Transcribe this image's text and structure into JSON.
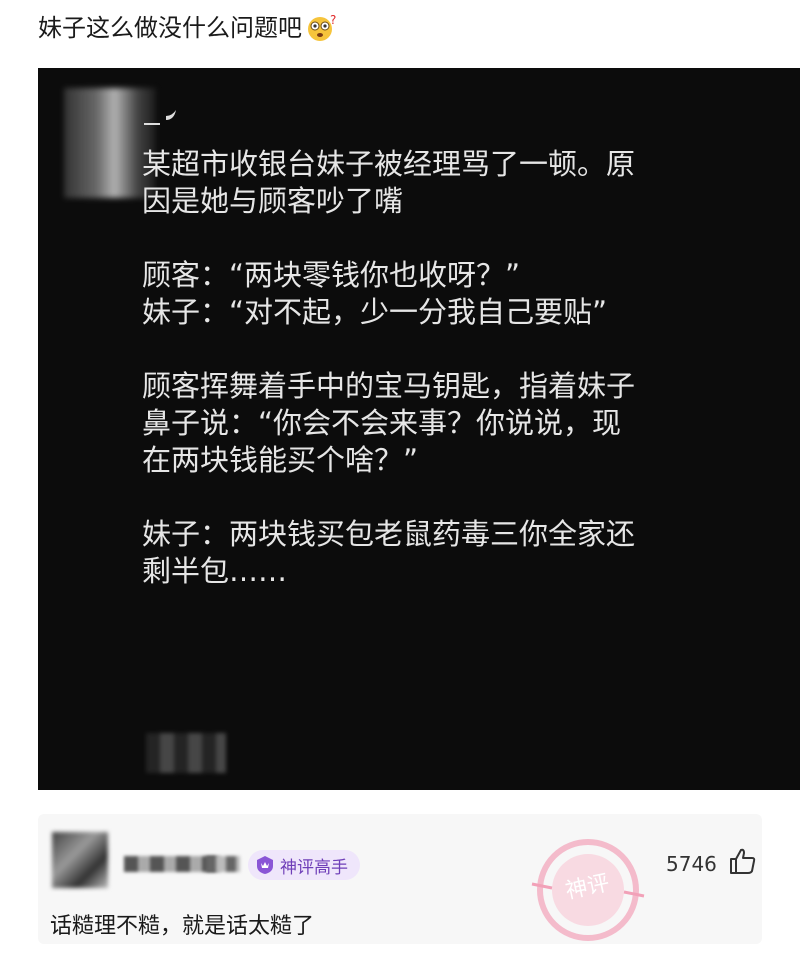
{
  "post": {
    "title": "妹子这么做没什么问题吧",
    "emoji_icon": "dizzy-face-emoji-icon"
  },
  "screenshot": {
    "username": "_",
    "paragraphs": [
      "某超市收银台妹子被经理骂了一顿。原\n因是她与顾客吵了嘴",
      "顾客：“两块零钱你也收呀？”\n妹子：“对不起，少一分我自己要贴”",
      "顾客挥舞着手中的宝马钥匙，指着妹子\n鼻子说：“你会不会来事？你说说，现\n在两块钱能买个啥？”",
      "妹子：两块钱买包老鼠药毒三你全家还\n剩半包……"
    ]
  },
  "comment": {
    "badge_label": "神评高手",
    "badge_icon": "crown-shield-icon",
    "like_count": "5746",
    "like_icon": "thumbs-up-icon",
    "text": "话糙理不糙，就是话太糙了",
    "stamp_text": "神评",
    "stamp_color": "#e8557f"
  },
  "colors": {
    "screenshot_bg": "#0c0c0c",
    "story_text": "#e6e6e6",
    "badge_bg": "#efe6fb",
    "badge_text": "#6f3fb8"
  }
}
